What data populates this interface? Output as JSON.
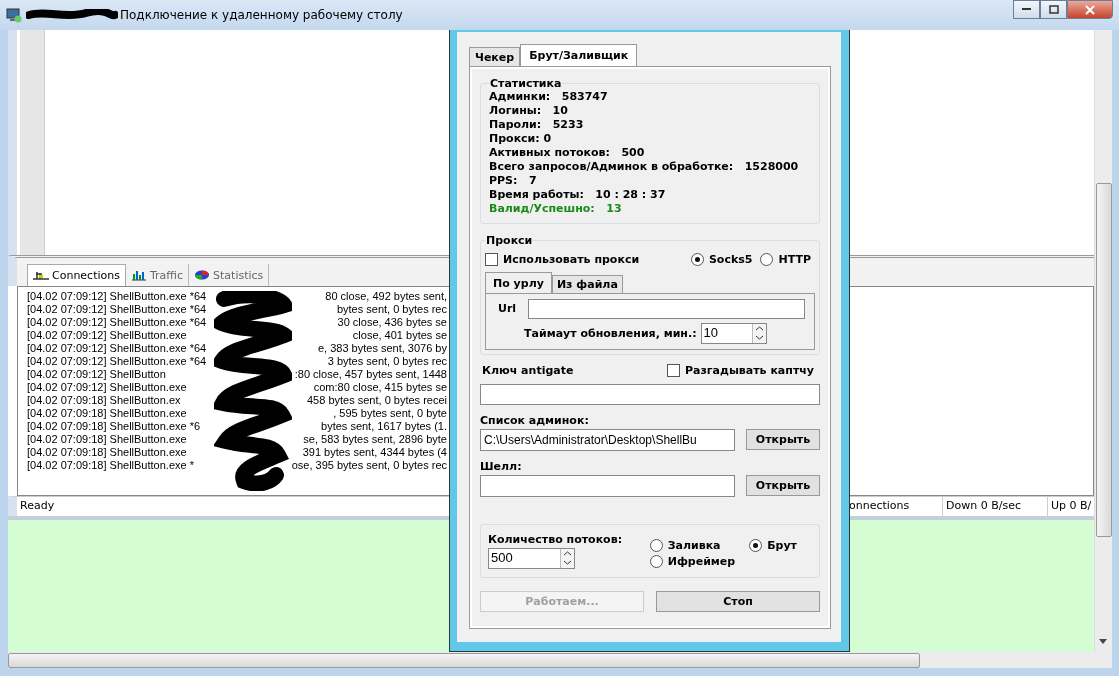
{
  "window": {
    "title": "Подключение к удаленному рабочему столу"
  },
  "app": {
    "tabs": [
      {
        "label": "Connections",
        "selected": true
      },
      {
        "label": "Traffic",
        "selected": false
      },
      {
        "label": "Statistics",
        "selected": false
      }
    ],
    "log": [
      {
        "start": "[04.02 07:09:12] ShellButton.exe *64",
        "end": "80 close, 492 bytes sent,"
      },
      {
        "start": "[04.02 07:09:12] ShellButton.exe *64",
        "end": "bytes sent, 0 bytes rec"
      },
      {
        "start": "[04.02 07:09:12] ShellButton.exe *64",
        "end": "30 close, 436 bytes se"
      },
      {
        "start": "[04.02 07:09:12] ShellButton.exe",
        "end": "close, 401 bytes se"
      },
      {
        "start": "[04.02 07:09:12] ShellButton.exe *64",
        "end": "e, 383 bytes sent, 3076 by"
      },
      {
        "start": "[04.02 07:09:12] ShellButton.exe *64",
        "end": "3 bytes sent, 0 bytes rec"
      },
      {
        "start": "[04.02 07:09:12] ShellButton",
        "end": ":80 close, 457 bytes sent, 1448"
      },
      {
        "start": "[04.02 07:09:12] ShellButton.exe",
        "end": "com:80 close, 415 bytes se"
      },
      {
        "start": "[04.02 07:09:18] ShellButton.ex",
        "end": "458 bytes sent, 0 bytes recei"
      },
      {
        "start": "[04.02 07:09:18] ShellButton.exe",
        "end": ", 595 bytes sent, 0 byte"
      },
      {
        "start": "[04.02 07:09:18] ShellButton.exe *6",
        "end": "bytes sent, 1617 bytes (1."
      },
      {
        "start": "[04.02 07:09:18] ShellButton.exe",
        "end": "se, 583 bytes sent, 2896 byte"
      },
      {
        "start": "[04.02 07:09:18] ShellButton.exe",
        "end": "391 bytes sent, 4344 bytes (4"
      },
      {
        "start": "[04.02 07:09:18] ShellButton.exe *",
        "end": "ose, 395 bytes sent, 0 bytes rec"
      }
    ],
    "status_bar": [
      "Ready",
      "onnections",
      "Down 0 B/sec",
      "Up 0 B/"
    ]
  },
  "dialog": {
    "tabs": [
      {
        "label": "Чекер",
        "selected": false
      },
      {
        "label": "Брут/Заливщик",
        "selected": true
      }
    ],
    "stats": {
      "title": "Статистика",
      "lines": [
        {
          "text": "Админки:   583747",
          "kind": "plain"
        },
        {
          "text": "Логины:   10",
          "kind": "plain"
        },
        {
          "text": "Пароли:   5233",
          "kind": "plain"
        },
        {
          "text": "Прокси: 0",
          "kind": "plain"
        },
        {
          "text": "Активных потоков:   500",
          "kind": "plain"
        },
        {
          "text": "Всего запросов/Админок в обработке:   1528000",
          "kind": "plain"
        },
        {
          "text": "PPS:   7",
          "kind": "plain"
        },
        {
          "text": "Время работы:   10 : 28 : 37",
          "kind": "plain"
        },
        {
          "text": "Валид/Успешно:   13",
          "kind": "success"
        }
      ]
    },
    "proxy": {
      "title": "Прокси",
      "use_proxy": {
        "label": "Использовать прокси",
        "checked": false
      },
      "types": [
        {
          "label": "Socks5",
          "selected": true
        },
        {
          "label": "HTTP",
          "selected": false
        }
      ],
      "tabs": [
        {
          "label": "По урлу",
          "selected": true
        },
        {
          "label": "Из файла",
          "selected": false
        }
      ],
      "url_label": "Url",
      "timeout_label": "Таймаут обновления, мин.:",
      "timeout": "10"
    },
    "antigate": {
      "label": "Ключ antigate",
      "solve_captcha": {
        "label": "Разгадывать каптчу",
        "checked": false
      }
    },
    "admin_list": {
      "label": "Список админок:",
      "value": "C:\\Users\\Administrator\\Desktop\\ShellBu",
      "button": "Открыть"
    },
    "shell": {
      "label": "Шелл:",
      "button": "Открыть"
    },
    "threads": {
      "label": "Количество потоков:",
      "value": "500",
      "modes": [
        {
          "label": "Заливка",
          "selected": false
        },
        {
          "label": "Брут",
          "selected": true
        },
        {
          "label": "Ифреймер",
          "selected": false
        }
      ]
    },
    "buttons": [
      {
        "label": "Работаем...",
        "disabled": true
      },
      {
        "label": "Стоп",
        "disabled": false
      }
    ]
  }
}
